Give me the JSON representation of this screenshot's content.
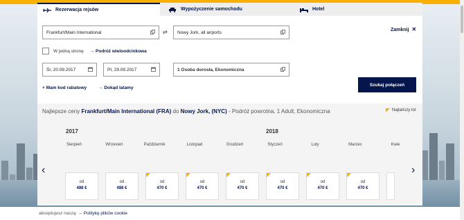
{
  "tabs": [
    {
      "label": "Rezerwacja rejsów",
      "icon": "airplane-icon"
    },
    {
      "label": "Wypożyczenie samochodu",
      "icon": "car-icon"
    },
    {
      "label": "Hotel",
      "icon": "bed-icon"
    }
  ],
  "search": {
    "from": "Frankfurt/Main International",
    "to": "Nowy Jork, all airports",
    "one_way_label": "W jedną stronę",
    "multi_city_label": "Podróż wieloodcinkowa",
    "depart_date": "Śr, 20.09.2017",
    "return_date": "Pt, 29.09.2017",
    "passengers": "1 Osoba dorosła, Ekonomiczna",
    "promo_label": "Mam kod rabatowy",
    "anywhere_label": "Dokąd latamy",
    "submit_label": "Szukaj połączeń",
    "close_label": "Zamknij"
  },
  "fares": {
    "title_prefix": "Najlepsze ceny ",
    "origin": "Frankfurt/Main International (FRA)",
    "to_word": " do ",
    "destination": "Nowy Jork, (NYC)",
    "title_suffix": " - Podróż powrotna, 1 Adult, Ekonomiczna",
    "legend_label": "Najtańszy lot",
    "years": [
      "2017",
      "2018"
    ],
    "months": [
      {
        "name": "Sierpień",
        "price": "488 €",
        "cheapest": false
      },
      {
        "name": "Wrzesień",
        "price": "488 €",
        "cheapest": false
      },
      {
        "name": "Październik",
        "price": "470 €",
        "cheapest": true
      },
      {
        "name": "Listopad",
        "price": "470 €",
        "cheapest": true
      },
      {
        "name": "Grudzień",
        "price": "470 €",
        "cheapest": true
      },
      {
        "name": "Styczeń",
        "price": "470 €",
        "cheapest": true
      },
      {
        "name": "Luty",
        "price": "470 €",
        "cheapest": true
      },
      {
        "name": "Marzec",
        "price": "470 €",
        "cheapest": true
      },
      {
        "name": "Kwie",
        "price": "",
        "cheapest": false
      }
    ],
    "from_label": "od"
  },
  "cookie": {
    "text": "akceptujesz naszą",
    "link": "Politykę plików cookie"
  },
  "colors": {
    "brand_blue": "#05164d",
    "accent_yellow": "#f9b000"
  }
}
